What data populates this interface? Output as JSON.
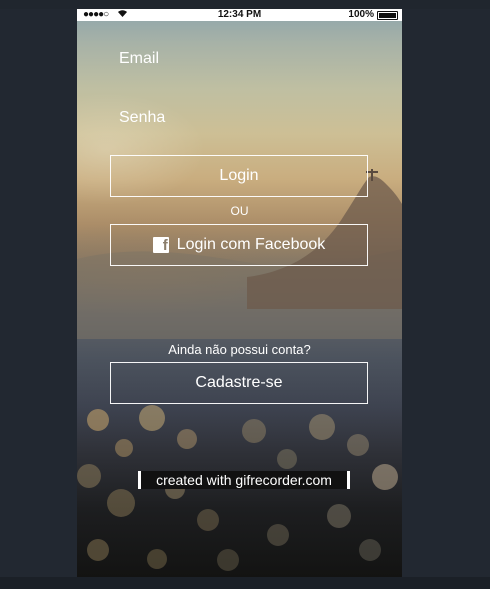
{
  "status_bar": {
    "signal": "●●●●○",
    "time": "12:34 PM",
    "battery": "100%"
  },
  "form": {
    "email_label": "Email",
    "password_label": "Senha",
    "login_button": "Login",
    "or_text": "OU",
    "facebook_button": "Login com Facebook",
    "no_account_text": "Ainda não possui conta?",
    "signup_button": "Cadastre-se"
  },
  "icons": {
    "wifi": "wifi-icon",
    "battery": "battery-icon",
    "facebook": "facebook-icon"
  },
  "watermark": "created with gifrecorder.com"
}
